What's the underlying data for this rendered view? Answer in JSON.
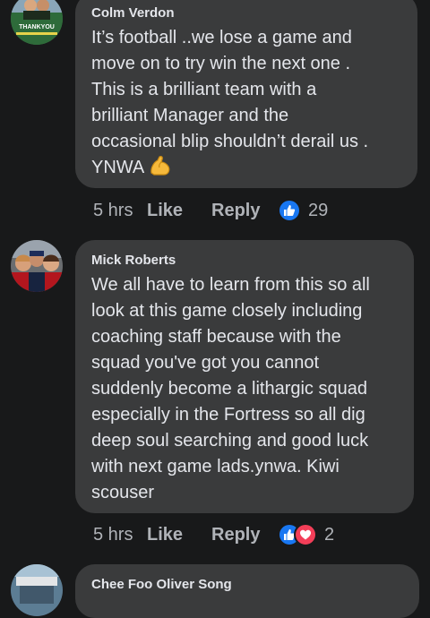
{
  "comments": [
    {
      "author": "Colm Verdon",
      "avatar_caption": "THANKYOU",
      "lines": [
        "It’s football ..we lose a game and",
        "move on to try win the next one .",
        "This is a brilliant team with a",
        "brilliant Manager and the",
        "occasional blip shouldn’t derail us .",
        "YNWA"
      ],
      "emoji": "flexed-biceps-emoji",
      "time": "5 hrs",
      "like_label": "Like",
      "reply_label": "Reply",
      "reactions": [
        "like"
      ],
      "reaction_count": "29"
    },
    {
      "author": "Mick Roberts",
      "lines": [
        "We all have to learn from this so all",
        "look at this game closely including",
        "coaching staff because with the",
        "squad you've got you cannot",
        "suddenly become a lithargic squad",
        "especially in the Fortress so all dig",
        "deep soul searching and good luck",
        "with next game lads.ynwa. Kiwi",
        "scouser"
      ],
      "time": "5 hrs",
      "like_label": "Like",
      "reply_label": "Reply",
      "reactions": [
        "like",
        "love"
      ],
      "reaction_count": "2"
    },
    {
      "author": "Chee Foo Oliver Song"
    }
  ],
  "colors": {
    "background": "#18191a",
    "bubble": "#3a3b3c",
    "text": "#e4e6eb",
    "meta_text": "#b0b3b8",
    "like_blue": "#1877f2",
    "love_red": "#f33e58"
  }
}
